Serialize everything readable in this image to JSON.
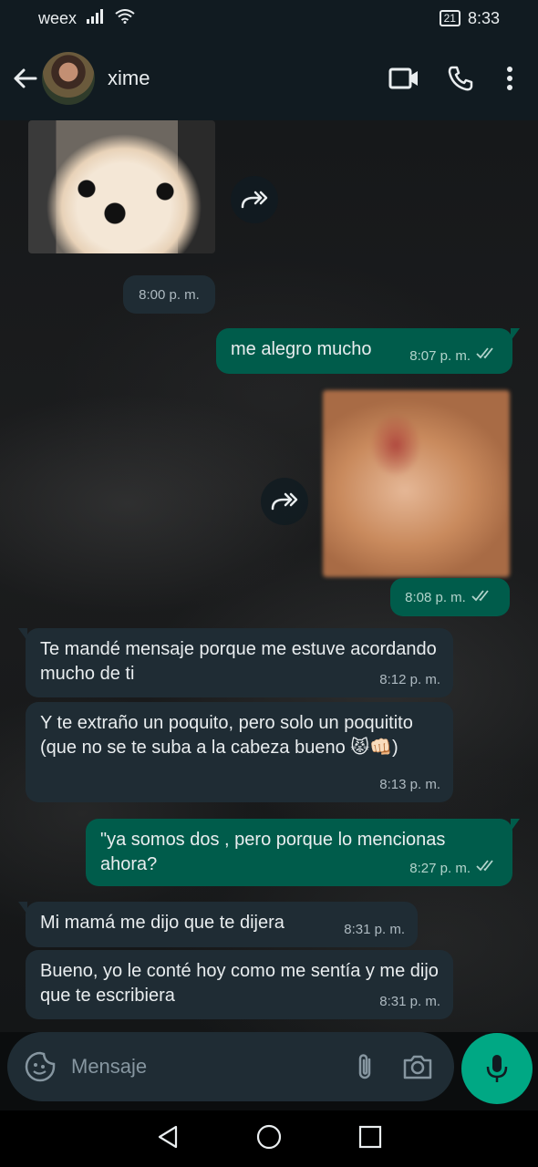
{
  "status_bar": {
    "carrier": "weex",
    "battery": "21",
    "time": "8:33"
  },
  "header": {
    "contact_name": "xime"
  },
  "messages": [
    {
      "type": "image",
      "direction": "in",
      "description_icon": "puppy-photo"
    },
    {
      "type": "time_chip",
      "time": "8:00 p. m."
    },
    {
      "type": "text",
      "direction": "out",
      "text": "me alegro mucho",
      "time": "8:07 p. m."
    },
    {
      "type": "image",
      "direction": "out",
      "description_icon": "blurry-photo"
    },
    {
      "type": "time_chip",
      "time": "8:08 p. m."
    },
    {
      "type": "text",
      "direction": "in",
      "text": "Te mandé mensaje porque me estuve acordando mucho de ti",
      "time": "8:12 p. m."
    },
    {
      "type": "text",
      "direction": "in",
      "text": "Y te extraño un poquito, pero solo un poquitito (que no se te suba a la cabeza bueno 😾👊🏻)",
      "time": "8:13 p. m."
    },
    {
      "type": "text",
      "direction": "out",
      "text": "\"ya somos dos , pero porque lo mencionas ahora?",
      "time": "8:27 p. m."
    },
    {
      "type": "text",
      "direction": "in",
      "text": "Mi mamá me dijo que te dijera",
      "time": "8:31 p. m."
    },
    {
      "type": "text",
      "direction": "in",
      "text": "Bueno, yo le conté hoy como me sentía y me dijo que te escribiera",
      "time": "8:31 p. m."
    }
  ],
  "composer": {
    "placeholder": "Mensaje"
  },
  "colors": {
    "outgoing_bubble": "#005c4b",
    "incoming_bubble": "#1f2c34",
    "accent": "#00a884",
    "header": "#111b21"
  }
}
